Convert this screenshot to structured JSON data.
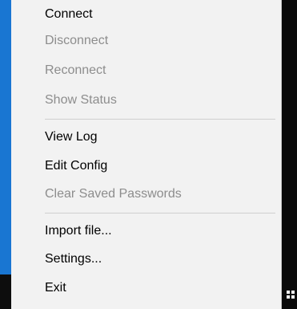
{
  "menu": {
    "group1": [
      {
        "label": "Connect",
        "enabled": true
      },
      {
        "label": "Disconnect",
        "enabled": false
      },
      {
        "label": "Reconnect",
        "enabled": false
      },
      {
        "label": "Show Status",
        "enabled": false
      }
    ],
    "group2": [
      {
        "label": "View Log",
        "enabled": true
      },
      {
        "label": "Edit Config",
        "enabled": true
      },
      {
        "label": "Clear Saved Passwords",
        "enabled": false
      }
    ],
    "group3": [
      {
        "label": "Import file...",
        "enabled": true
      },
      {
        "label": "Settings...",
        "enabled": true
      },
      {
        "label": "Exit",
        "enabled": true
      }
    ]
  },
  "colors": {
    "menu_background": "#f2f2f2",
    "enabled_text": "#000000",
    "disabled_text": "#8d8d8d",
    "separator": "#cfcfcf",
    "desktop_accent": "#1976d2"
  },
  "icons": {
    "tray": "tray-app-icon"
  }
}
